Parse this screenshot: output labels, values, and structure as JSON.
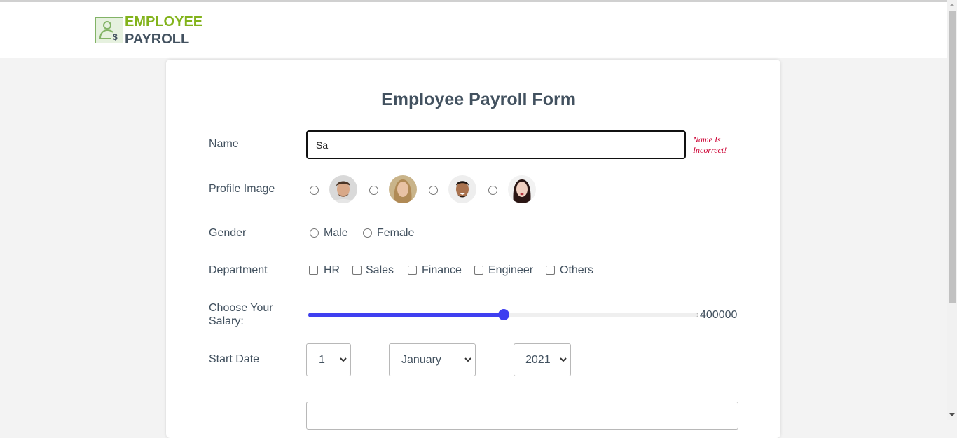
{
  "header": {
    "logo_line1": "EMPLOYEE",
    "logo_line2": "PAYROLL",
    "logo_icon": "user-dollar-icon"
  },
  "form": {
    "title": "Employee Payroll Form",
    "name": {
      "label": "Name",
      "value": "Sa",
      "error": "Name Is Incorrect!"
    },
    "profile_image": {
      "label": "Profile Image",
      "options": [
        "avatar-man-1",
        "avatar-woman-1",
        "avatar-man-2",
        "avatar-woman-2"
      ]
    },
    "gender": {
      "label": "Gender",
      "options": [
        "Male",
        "Female"
      ]
    },
    "department": {
      "label": "Department",
      "options": [
        "HR",
        "Sales",
        "Finance",
        "Engineer",
        "Others"
      ]
    },
    "salary": {
      "label_line1": "Choose Your",
      "label_line2": "Salary:",
      "value": "400000",
      "fraction": 0.5
    },
    "start_date": {
      "label": "Start Date",
      "day": "1",
      "month": "January",
      "year": "2021"
    }
  },
  "colors": {
    "brand_green": "#82b31b",
    "text": "#42515f",
    "error": "#cc0033",
    "slider": "#3f3ff0"
  }
}
